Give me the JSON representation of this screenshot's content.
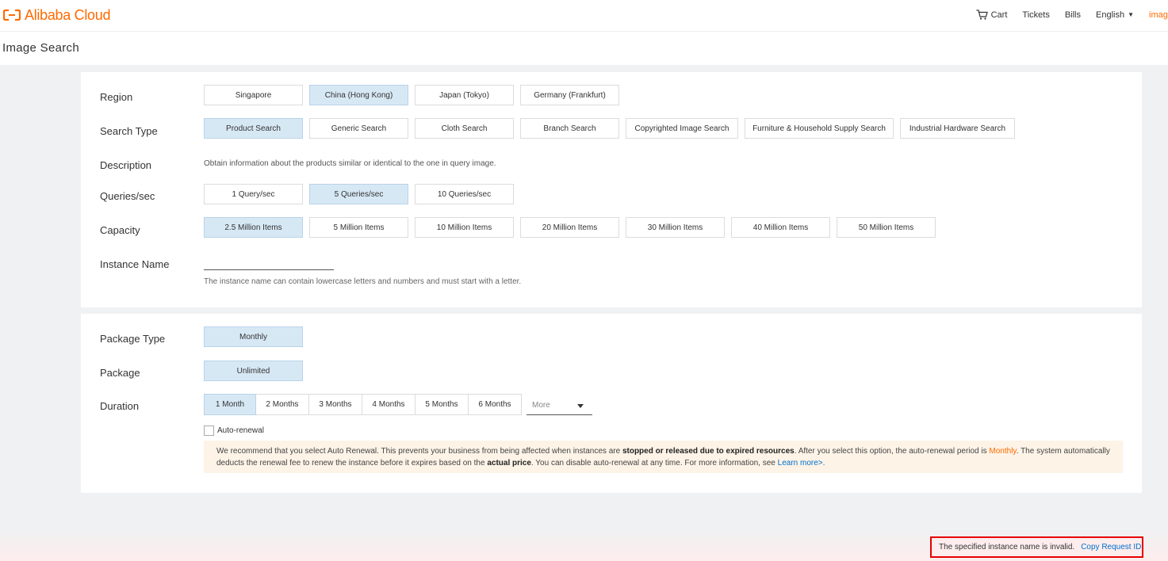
{
  "header": {
    "logo_text": "Alibaba Cloud",
    "nav": {
      "cart": "Cart",
      "tickets": "Tickets",
      "bills": "Bills",
      "language": "English",
      "user": "imag"
    }
  },
  "page_title": "Image Search",
  "config": {
    "region": {
      "label": "Region",
      "options": [
        "Singapore",
        "China (Hong Kong)",
        "Japan (Tokyo)",
        "Germany (Frankfurt)"
      ],
      "selected": "China (Hong Kong)"
    },
    "search_type": {
      "label": "Search Type",
      "options": [
        "Product Search",
        "Generic Search",
        "Cloth Search",
        "Branch Search",
        "Copyrighted Image Search",
        "Furniture & Household Supply Search",
        "Industrial Hardware Search"
      ],
      "selected": "Product Search"
    },
    "description": {
      "label": "Description",
      "text": "Obtain information about the products similar or identical to the one in query image."
    },
    "queries": {
      "label": "Queries/sec",
      "options": [
        "1 Query/sec",
        "5 Queries/sec",
        "10 Queries/sec"
      ],
      "selected": "5 Queries/sec"
    },
    "capacity": {
      "label": "Capacity",
      "options": [
        "2.5 Million Items",
        "5 Million Items",
        "10 Million Items",
        "20 Million Items",
        "30 Million Items",
        "40 Million Items",
        "50 Million Items"
      ],
      "selected": "2.5 Million Items"
    },
    "instance_name": {
      "label": "Instance Name",
      "value": "",
      "hint": "The instance name can contain lowercase letters and numbers and must start with a letter."
    }
  },
  "billing": {
    "package_type": {
      "label": "Package Type",
      "value": "Monthly"
    },
    "package": {
      "label": "Package",
      "value": "Unlimited"
    },
    "duration": {
      "label": "Duration",
      "options": [
        "1 Month",
        "2 Months",
        "3 Months",
        "4 Months",
        "5 Months",
        "6 Months"
      ],
      "selected": "1 Month",
      "more_label": "More"
    },
    "auto_renewal": {
      "label": "Auto-renewal",
      "checked": false
    },
    "notice": {
      "t1": "We recommend that you select Auto Renewal. This prevents your business from being affected when instances are ",
      "b1": "stopped or released due to expired resources",
      "t2": ". After you select this option, the auto-renewal period is ",
      "period": "Monthly",
      "t3": ". The system automatically deducts the renewal fee to renew the instance before it expires based on the ",
      "b2": "actual price",
      "t4": ". You can disable auto-renewal at any time. For more information, see ",
      "link": "Learn more>."
    }
  },
  "error": {
    "message": "The specified instance name is invalid.",
    "copy_label": "Copy Request ID"
  },
  "colors": {
    "brand": "#ff6a00",
    "selected_bg": "#d7e8f5",
    "error_border": "#e60000",
    "link": "#0070cc"
  }
}
